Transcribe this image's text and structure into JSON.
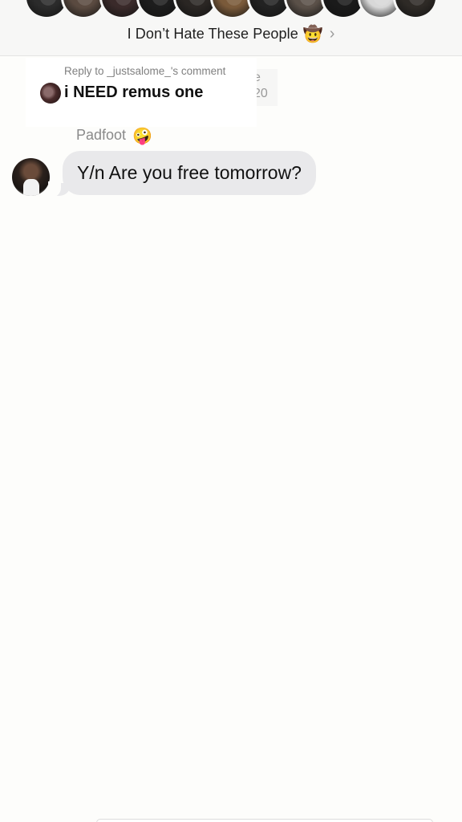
{
  "header": {
    "title": "I Don’t Hate These People",
    "title_emoji": "🤠",
    "chevron": "›",
    "avatars": [
      {
        "color": "#2b2b2b"
      },
      {
        "color": "#5a4a40"
      },
      {
        "color": "#3a2a2a"
      },
      {
        "color": "#1d1d1d"
      },
      {
        "color": "#2a2623"
      },
      {
        "color": "#7a5a3a"
      },
      {
        "color": "#222222"
      },
      {
        "color": "#5a5048"
      },
      {
        "color": "#1a1a1a"
      },
      {
        "color": "#d8d8d8"
      },
      {
        "color": "#2e2a26"
      }
    ]
  },
  "reply_comment": {
    "label": "Reply to _justsalome_'s comment",
    "text": "i NEED remus one",
    "ghost_text_1": "e",
    "ghost_text_2": "20"
  },
  "message": {
    "sender_name": "Padfoot",
    "sender_emoji": "🤪",
    "text": "Y/n Are you free tomorrow?"
  },
  "colors": {
    "background": "#fdfdfb",
    "bubble": "#e9e9eb",
    "header_bg": "#f7f7f6"
  }
}
